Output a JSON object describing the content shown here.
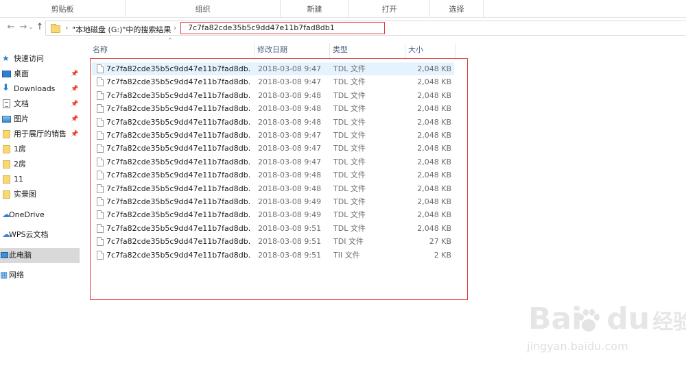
{
  "ribbon": {
    "groups": [
      "剪贴板",
      "组织",
      "新建",
      "打开",
      "选择"
    ]
  },
  "address": {
    "crumb_root": "\"本地磁盘 (G:)\"中的搜索结果",
    "crumb_current": "7c7fa82cde35b5c9dd47e11b7fad8db1"
  },
  "sidebar": {
    "items": [
      {
        "label": "快速访问",
        "icon": "star-icon"
      },
      {
        "label": "桌面",
        "icon": "desktop-icon",
        "pinned": true
      },
      {
        "label": "Downloads",
        "icon": "download-icon",
        "pinned": true
      },
      {
        "label": "文档",
        "icon": "document-icon",
        "pinned": true
      },
      {
        "label": "图片",
        "icon": "pictures-icon",
        "pinned": true
      },
      {
        "label": "用于展厅的销售",
        "icon": "folder-icon",
        "pinned": true
      },
      {
        "label": "1房",
        "icon": "folder-icon"
      },
      {
        "label": "2房",
        "icon": "folder-icon"
      },
      {
        "label": "11",
        "icon": "folder-icon"
      },
      {
        "label": "实景图",
        "icon": "folder-icon"
      },
      {
        "label": "OneDrive",
        "icon": "cloud-icon"
      },
      {
        "label": "WPS云文档",
        "icon": "wps-cloud-icon"
      },
      {
        "label": "此电脑",
        "icon": "computer-icon",
        "selected": true
      },
      {
        "label": "网络",
        "icon": "network-icon"
      }
    ]
  },
  "columns": {
    "name": "名称",
    "date": "修改日期",
    "type": "类型",
    "size": "大小"
  },
  "files": [
    {
      "name": "7c7fa82cde35b5c9dd47e11b7fad8db...",
      "date": "2018-03-08 9:47",
      "type": "TDL 文件",
      "size": "2,048 KB"
    },
    {
      "name": "7c7fa82cde35b5c9dd47e11b7fad8db...",
      "date": "2018-03-08 9:47",
      "type": "TDL 文件",
      "size": "2,048 KB"
    },
    {
      "name": "7c7fa82cde35b5c9dd47e11b7fad8db...",
      "date": "2018-03-08 9:48",
      "type": "TDL 文件",
      "size": "2,048 KB"
    },
    {
      "name": "7c7fa82cde35b5c9dd47e11b7fad8db...",
      "date": "2018-03-08 9:48",
      "type": "TDL 文件",
      "size": "2,048 KB"
    },
    {
      "name": "7c7fa82cde35b5c9dd47e11b7fad8db...",
      "date": "2018-03-08 9:48",
      "type": "TDL 文件",
      "size": "2,048 KB"
    },
    {
      "name": "7c7fa82cde35b5c9dd47e11b7fad8db...",
      "date": "2018-03-08 9:47",
      "type": "TDL 文件",
      "size": "2,048 KB"
    },
    {
      "name": "7c7fa82cde35b5c9dd47e11b7fad8db...",
      "date": "2018-03-08 9:47",
      "type": "TDL 文件",
      "size": "2,048 KB"
    },
    {
      "name": "7c7fa82cde35b5c9dd47e11b7fad8db...",
      "date": "2018-03-08 9:47",
      "type": "TDL 文件",
      "size": "2,048 KB"
    },
    {
      "name": "7c7fa82cde35b5c9dd47e11b7fad8db...",
      "date": "2018-03-08 9:48",
      "type": "TDL 文件",
      "size": "2,048 KB"
    },
    {
      "name": "7c7fa82cde35b5c9dd47e11b7fad8db...",
      "date": "2018-03-08 9:48",
      "type": "TDL 文件",
      "size": "2,048 KB"
    },
    {
      "name": "7c7fa82cde35b5c9dd47e11b7fad8db...",
      "date": "2018-03-08 9:49",
      "type": "TDL 文件",
      "size": "2,048 KB"
    },
    {
      "name": "7c7fa82cde35b5c9dd47e11b7fad8db...",
      "date": "2018-03-08 9:49",
      "type": "TDL 文件",
      "size": "2,048 KB"
    },
    {
      "name": "7c7fa82cde35b5c9dd47e11b7fad8db...",
      "date": "2018-03-08 9:51",
      "type": "TDL 文件",
      "size": "2,048 KB"
    },
    {
      "name": "7c7fa82cde35b5c9dd47e11b7fad8db...",
      "date": "2018-03-08 9:51",
      "type": "TDI 文件",
      "size": "27 KB"
    },
    {
      "name": "7c7fa82cde35b5c9dd47e11b7fad8db...",
      "date": "2018-03-08 9:51",
      "type": "TII 文件",
      "size": "2 KB"
    }
  ],
  "watermark": {
    "logo_left": "Bai",
    "logo_right": "du",
    "logo_cn": "经验",
    "url": "jingyan.baidu.com"
  },
  "colors": {
    "annotation_red": "#e0403e",
    "hover_row": "#e5f3ff",
    "selected_nav": "#d9d9d9"
  }
}
